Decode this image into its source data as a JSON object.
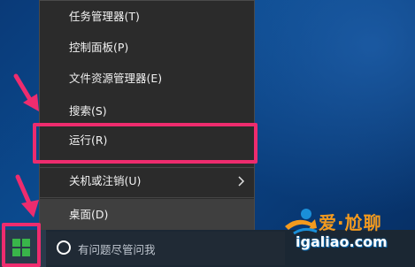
{
  "context_menu": {
    "items": [
      {
        "label": "任务管理器(T)"
      },
      {
        "label": "控制面板(P)"
      },
      {
        "label": "文件资源管理器(E)"
      },
      {
        "label": "搜索(S)"
      },
      {
        "label": "运行(R)"
      },
      {
        "label": "关机或注销(U)"
      },
      {
        "label": "桌面(D)"
      }
    ]
  },
  "taskbar": {
    "search_placeholder": "有问题尽管问我"
  },
  "watermark": {
    "brand": "爱·尬聊",
    "url": "igaliao.com"
  },
  "colors": {
    "highlight": "#ee2c6e",
    "menu_bg": "#2b2b2b",
    "desktop_bg": "#0b4a8e"
  },
  "icons": [
    "windows-logo-icon",
    "search-circle-icon",
    "submenu-arrow-icon",
    "pointer-arrow-icon"
  ]
}
